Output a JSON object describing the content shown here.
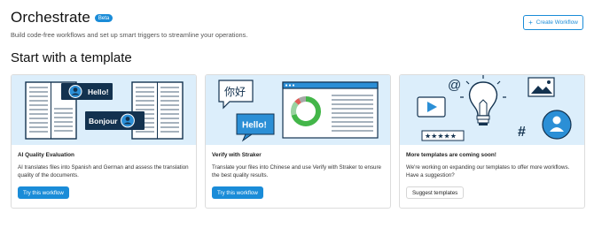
{
  "header": {
    "title": "Orchestrate",
    "badge": "Beta",
    "subtitle": "Build code-free workflows and set up smart triggers to streamline your operations.",
    "create_button": "Create Workflow"
  },
  "section": {
    "title": "Start with a template"
  },
  "cards": [
    {
      "title": "AI Quality Evaluation",
      "description": "AI translates files into Spanish and German and assess the translation quality of the documents.",
      "button": "Try this workflow",
      "art": {
        "bubble1": "Hello!",
        "bubble2": "Bonjour"
      }
    },
    {
      "title": "Verify with Straker",
      "description": "Translate your files into Chinese and use Verify with Straker to ensure the best quality results.",
      "button": "Try this workflow",
      "art": {
        "bubble1": "你好",
        "bubble2": "Hello!"
      }
    },
    {
      "title": "More templates are coming soon!",
      "description": "We're working on expanding our templates to offer more workflows. Have a suggestion?",
      "button": "Suggest templates",
      "art": {
        "at": "@",
        "hash": "#"
      }
    }
  ],
  "colors": {
    "accent": "#1a8cd8",
    "art_bg": "#dceefb",
    "dark_navy": "#13324f"
  }
}
